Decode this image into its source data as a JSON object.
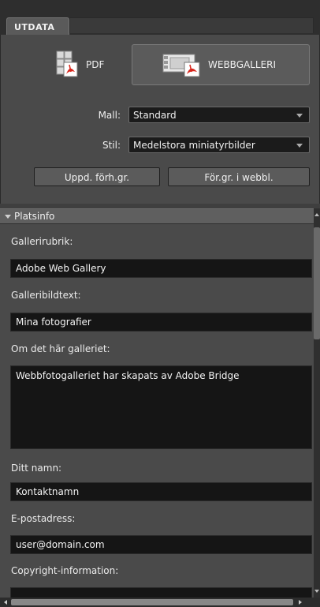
{
  "tabs": {
    "active_label": "UTDATA"
  },
  "output": {
    "pdf_label": "PDF",
    "web_label": "WEBBGALLERI",
    "template_label": "Mall:",
    "template_value": "Standard",
    "style_label": "Stil:",
    "style_value": "Medelstora miniatyrbilder",
    "refresh_preview_label": "Uppd. förh.gr.",
    "browser_preview_label": "För.gr. i webbl."
  },
  "site_info": {
    "title": "Platsinfo",
    "gallery_title_label": "Gallerirubrik:",
    "gallery_title_value": "Adobe Web Gallery",
    "gallery_caption_label": "Galleribildtext:",
    "gallery_caption_value": "Mina fotografier",
    "about_label": "Om det här galleriet:",
    "about_value": "Webbfotogalleriet har skapats av Adobe Bridge",
    "name_label": "Ditt namn:",
    "name_value": "Kontaktnamn",
    "email_label": "E-postadress:",
    "email_value": "user@domain.com",
    "copyright_label": "Copyright-information:",
    "copyright_value": ""
  },
  "icons": {
    "pdf": "pdf-document-icon",
    "web": "web-gallery-icon",
    "collapse": "disclosure-triangle-icon"
  },
  "colors": {
    "panel_bg": "#4a4a4a",
    "field_bg": "#151515",
    "tab_bg": "#5a5a5a",
    "pdf_red": "#d8261c"
  }
}
